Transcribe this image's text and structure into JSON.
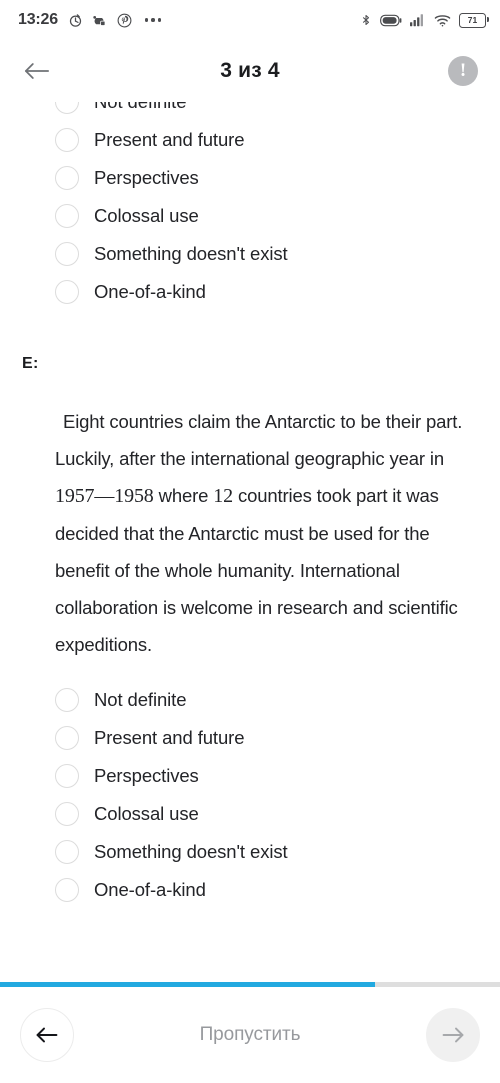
{
  "status_bar": {
    "time": "13:26",
    "battery_percent": "71",
    "left_icons": [
      "clock-timer-icon",
      "game-controller-icon",
      "pinterest-icon",
      "more-dots-icon"
    ],
    "right_icons": [
      "bluetooth-icon",
      "battery-saver-icon",
      "signal-bars-icon",
      "wifi-icon",
      "battery-icon"
    ]
  },
  "header": {
    "back_icon": "arrow-left-icon",
    "title": "3 из 4",
    "info_icon": "exclamation-circle-icon",
    "info_glyph": "!"
  },
  "question_top": {
    "options": [
      {
        "label": "Not definite",
        "selected": false
      },
      {
        "label": "Present and future",
        "selected": false
      },
      {
        "label": "Perspectives",
        "selected": false
      },
      {
        "label": "Colossal use",
        "selected": false
      },
      {
        "label": "Something doesn't exist",
        "selected": false
      },
      {
        "label": "One-of-a-kind",
        "selected": false
      }
    ]
  },
  "question_current": {
    "label": "E:",
    "passage_part1": "Eight countries claim the Antarctic to be their part. Luckily, after the international geographic year in ",
    "passage_years": "1957—1958",
    "passage_part2": " where ",
    "passage_count": "12",
    "passage_part3": " countries took part it was decided that the Antarctic must be used for the benefit of the whole humanity. International collaboration is welcome in research and scientific expeditions.",
    "options": [
      {
        "label": "Not definite",
        "selected": false
      },
      {
        "label": "Present and future",
        "selected": false
      },
      {
        "label": "Perspectives",
        "selected": false
      },
      {
        "label": "Colossal use",
        "selected": false
      },
      {
        "label": "Something doesn't exist",
        "selected": false
      },
      {
        "label": "One-of-a-kind",
        "selected": false
      }
    ]
  },
  "bottom_bar": {
    "progress_percent": "75",
    "prev_icon": "arrow-left-icon",
    "skip_label": "Пропустить",
    "next_icon": "arrow-right-icon"
  },
  "colors": {
    "progress_fill": "#22a9e0",
    "progress_track": "#dedede",
    "text_primary": "#232428",
    "text_muted": "#97999d"
  }
}
